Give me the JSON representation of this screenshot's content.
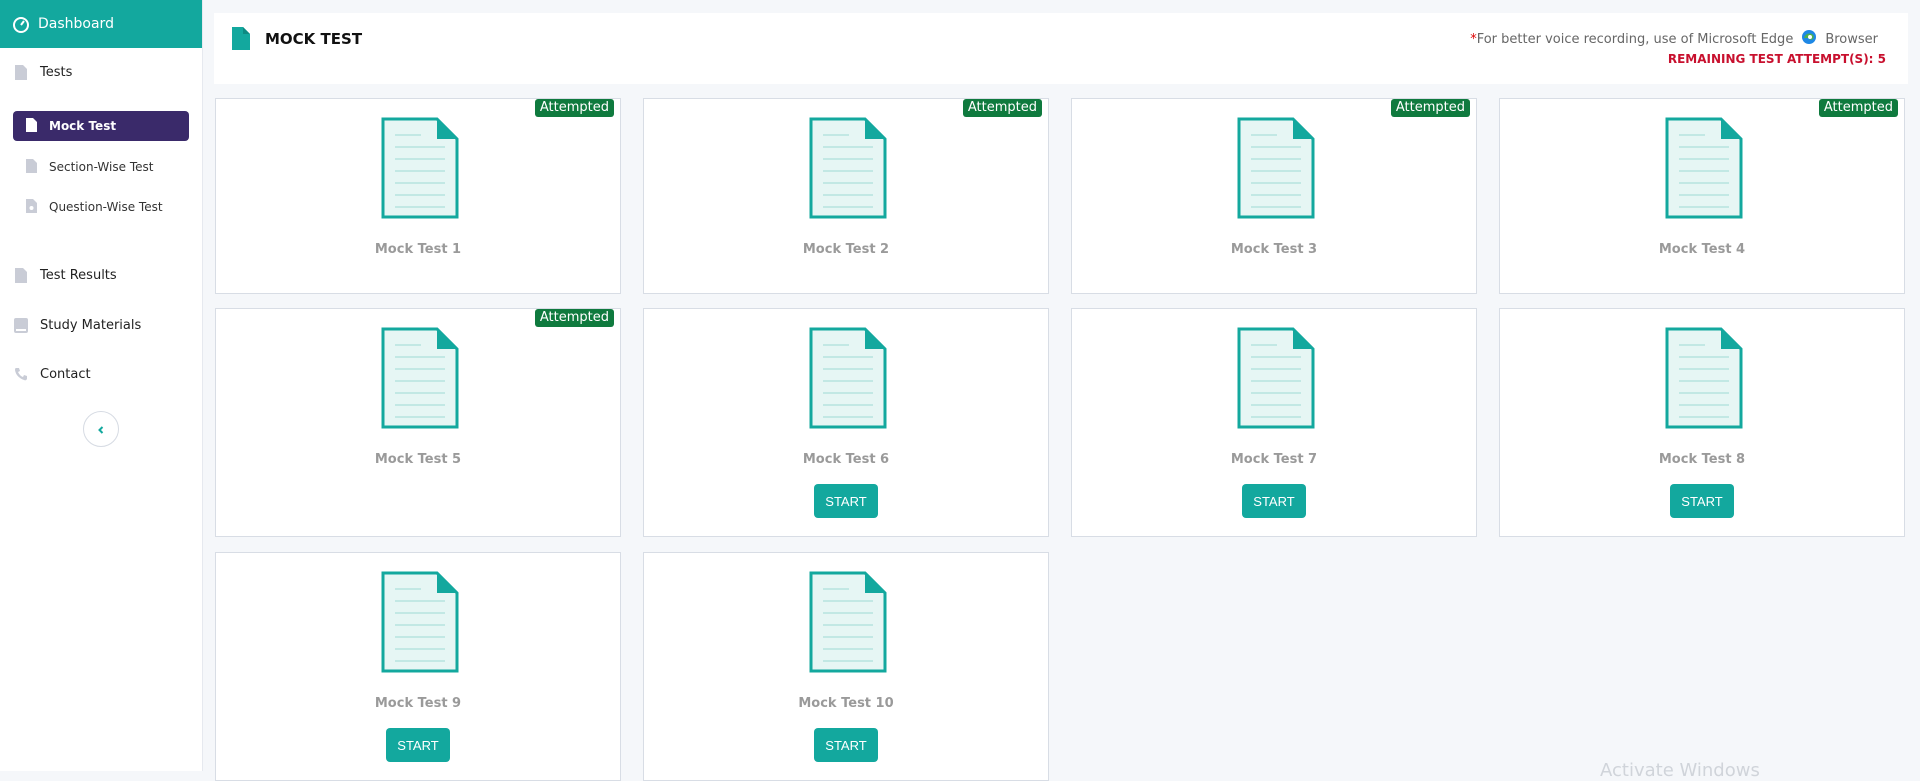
{
  "sidebar": {
    "dashboard": "Dashboard",
    "tests": "Tests",
    "sub_items": [
      "Mock Test",
      "Section-Wise Test",
      "Question-Wise Test"
    ],
    "test_results": "Test Results",
    "study_materials": "Study Materials",
    "contact": "Contact"
  },
  "header": {
    "title": "MOCK TEST",
    "note_star": "*",
    "note": "For better voice recording, use of Microsoft Edge",
    "browser": "Browser",
    "remaining": "REMAINING TEST ATTEMPT(S): 5"
  },
  "cards": [
    {
      "label": "Mock Test 1",
      "badge": "Attempted"
    },
    {
      "label": "Mock Test 2",
      "badge": "Attempted"
    },
    {
      "label": "Mock Test 3",
      "badge": "Attempted"
    },
    {
      "label": "Mock Test 4",
      "badge": "Attempted"
    },
    {
      "label": "Mock Test 5",
      "badge": "Attempted"
    },
    {
      "label": "Mock Test 6",
      "button": "START"
    },
    {
      "label": "Mock Test 7",
      "button": "START"
    },
    {
      "label": "Mock Test 8",
      "button": "START"
    },
    {
      "label": "Mock Test 9",
      "button": "START"
    },
    {
      "label": "Mock Test 10",
      "button": "START"
    }
  ],
  "watermark": "Activate Windows",
  "colors": {
    "accent": "#13a89e",
    "active_nav": "#3a2a6a",
    "attempted": "#0f7a3e",
    "remaining": "#c8102e"
  }
}
